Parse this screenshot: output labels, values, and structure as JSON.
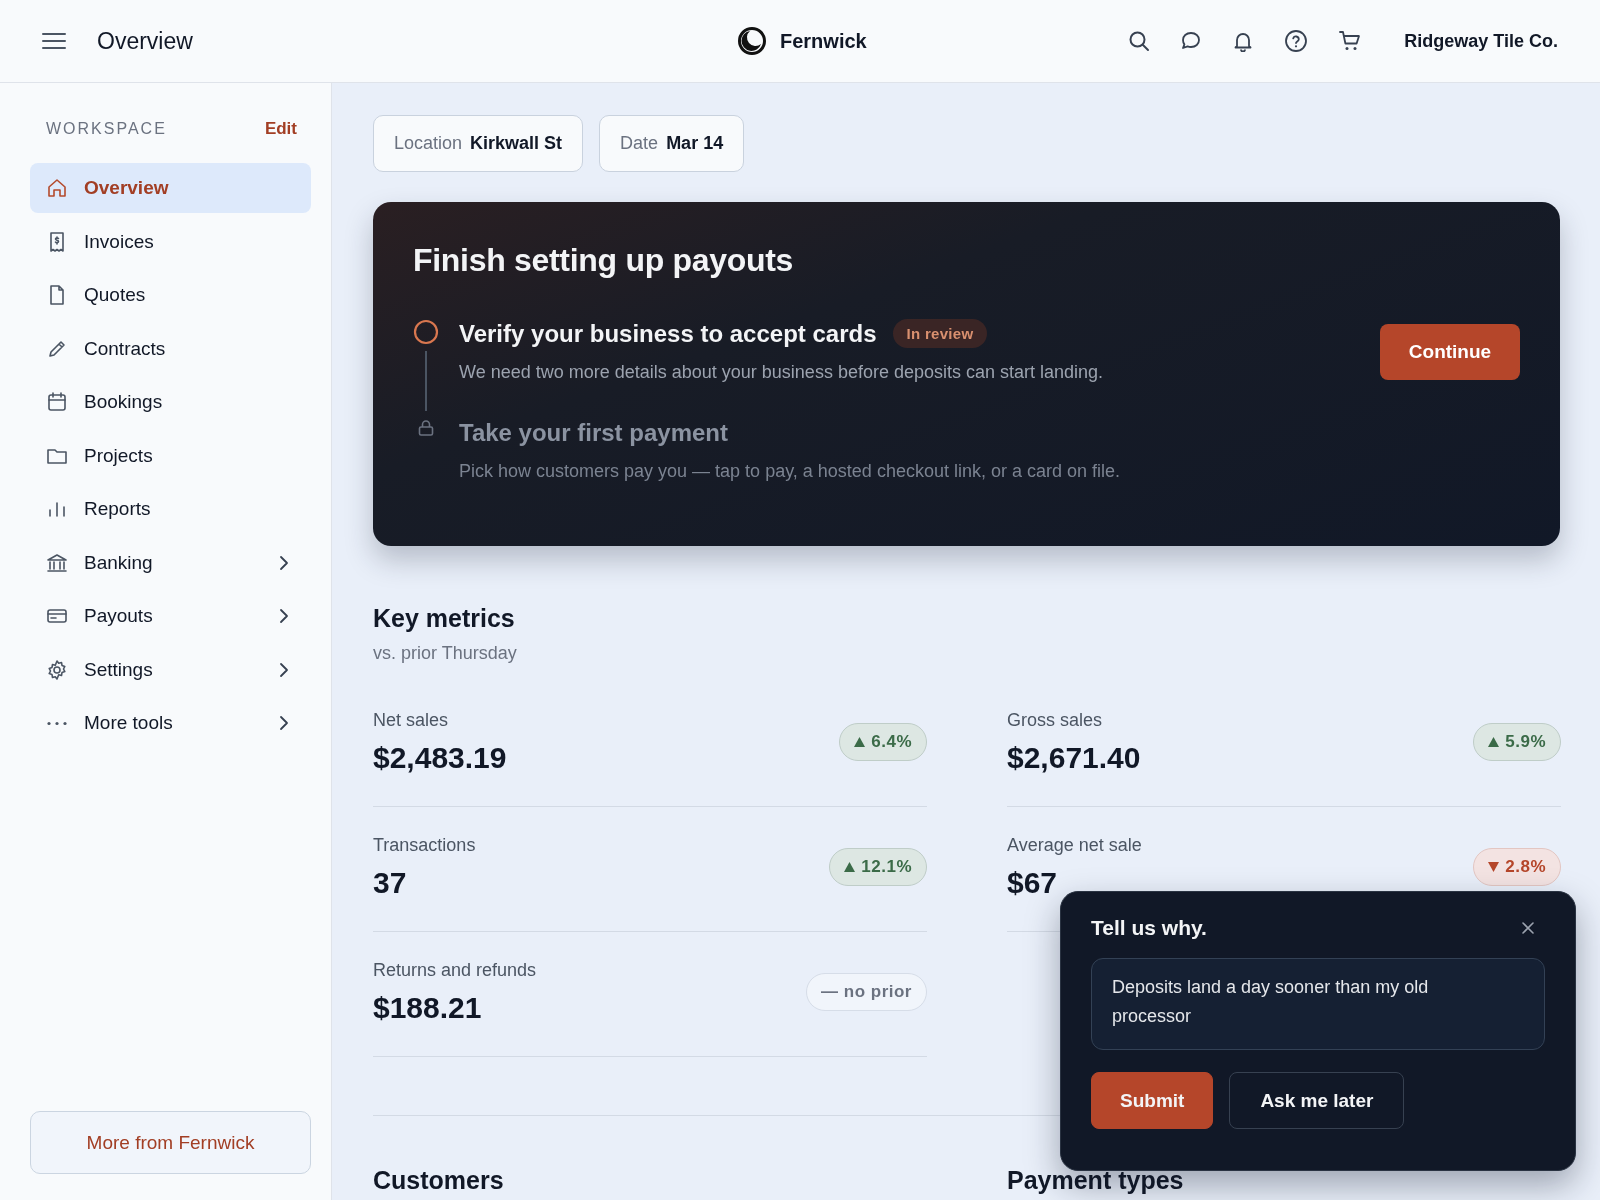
{
  "header": {
    "page_title": "Overview",
    "brand": "Fernwick",
    "account": "Ridgeway Tile Co."
  },
  "sidebar": {
    "section_label": "WORKSPACE",
    "edit_link": "Edit",
    "items": [
      {
        "label": "Overview",
        "selected": true,
        "expandable": false
      },
      {
        "label": "Invoices",
        "selected": false,
        "expandable": false
      },
      {
        "label": "Quotes",
        "selected": false,
        "expandable": false
      },
      {
        "label": "Contracts",
        "selected": false,
        "expandable": false
      },
      {
        "label": "Bookings",
        "selected": false,
        "expandable": false
      },
      {
        "label": "Projects",
        "selected": false,
        "expandable": false
      },
      {
        "label": "Reports",
        "selected": false,
        "expandable": false
      },
      {
        "label": "Banking",
        "selected": false,
        "expandable": true
      },
      {
        "label": "Payouts",
        "selected": false,
        "expandable": true
      },
      {
        "label": "Settings",
        "selected": false,
        "expandable": true
      },
      {
        "label": "More tools",
        "selected": false,
        "expandable": true
      }
    ],
    "footer_button": "More from Fernwick"
  },
  "filters": [
    {
      "label": "Location",
      "value": "Kirkwall St"
    },
    {
      "label": "Date",
      "value": "Mar 14"
    }
  ],
  "setup_card": {
    "title": "Finish setting up payouts",
    "steps": [
      {
        "kind": "current",
        "title": "Verify your business to accept cards",
        "badge": "In review",
        "description": "We need two more details about your business before deposits can start landing."
      },
      {
        "kind": "locked",
        "title": "Take your first payment",
        "description": "Pick how customers pay you — tap to pay, a hosted checkout link, or a card on file."
      }
    ],
    "button": "Continue"
  },
  "key_metrics": {
    "title": "Key metrics",
    "subtitle": "vs. prior Thursday",
    "items": [
      {
        "label": "Net sales",
        "value": "$2,483.19",
        "kind": "increase",
        "change": "6.4%"
      },
      {
        "label": "Gross sales",
        "value": "$2,671.40",
        "kind": "increase",
        "change": "5.9%"
      },
      {
        "label": "Transactions",
        "value": "37",
        "kind": "increase",
        "change": "12.1%"
      },
      {
        "label": "Average net sale",
        "value": "$67",
        "kind": "decrease",
        "change": "2.8%"
      },
      {
        "label": "Returns and refunds",
        "value": "$188.21",
        "kind": "neutral",
        "change": "— no prior"
      }
    ]
  },
  "sections": [
    "Customers",
    "Payment types"
  ],
  "feedback_popup": {
    "title": "Tell us why.",
    "answer": "Deposits land a day sooner than my old processor",
    "buttons": [
      "Submit",
      "Ask me later"
    ]
  }
}
